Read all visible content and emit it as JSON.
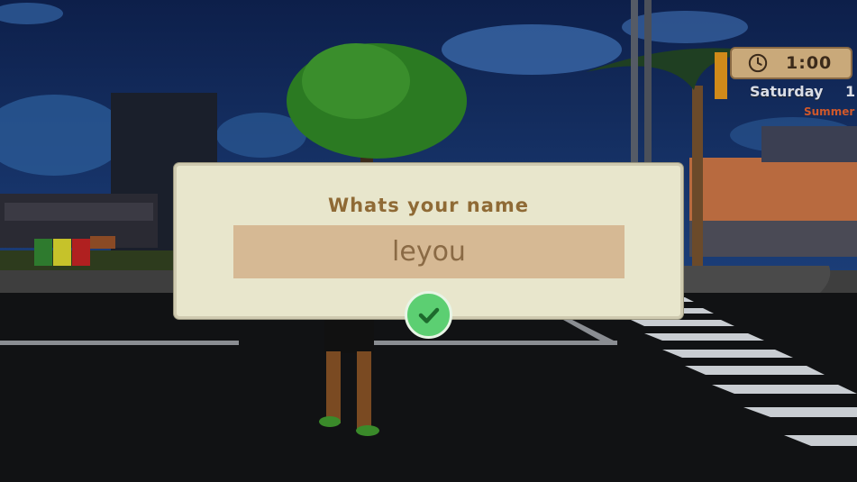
{
  "hud": {
    "time": "1:00",
    "weekday": "Saturday",
    "day": "1",
    "season": "Summer",
    "icons": {
      "clock": "clock-icon"
    }
  },
  "dialog": {
    "title": "Whats your name",
    "name_value": "leyou",
    "confirm_icon": "checkmark-icon"
  },
  "colors": {
    "dialog_bg": "#e8e6cc",
    "input_bg": "#d6b994",
    "title_text": "#8f6a35",
    "confirm_green": "#5ccf72",
    "season_text": "#d0582a"
  }
}
